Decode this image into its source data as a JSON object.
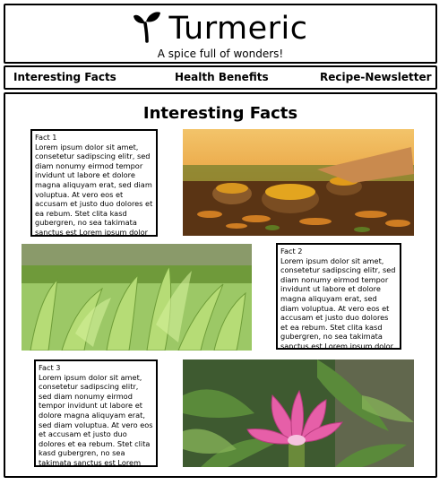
{
  "header": {
    "title": "Turmeric",
    "tagline": "A spice full of wonders!",
    "logo_icon": "sprout-icon"
  },
  "nav": {
    "items": [
      {
        "label": "Interesting Facts"
      },
      {
        "label": "Health Benefits"
      },
      {
        "label": "Recipe-Newsletter"
      }
    ]
  },
  "main": {
    "title": "Interesting Facts",
    "facts": [
      {
        "title": "Fact 1",
        "text": "Lorem ipsum dolor sit amet, consetetur sadipscing elitr, sed diam nonumy eirmod tempor invidunt ut labore et dolore magna aliquyam erat, sed diam voluptua. At vero eos et accusam et justo duo dolores et ea rebum. Stet clita kasd gubergren, no sea takimata sanctus est Lorem ipsum dolor sit amet. Lorem ipsum dolor sit amet, consetetur sadipscing elitr, sed"
      },
      {
        "title": "Fact 2",
        "text": "Lorem ipsum dolor sit amet, consetetur sadipscing elitr, sed diam nonumy eirmod tempor invidunt ut labore et dolore magna aliquyam erat, sed diam voluptua. At vero eos et accusam et justo duo dolores et ea rebum. Stet clita kasd gubergren, no sea takimata sanctus est Lorem ipsum dolor sit amet. Lorem ipsum dolor sit amet, consetetur sadipscing elitr, sed"
      },
      {
        "title": "Fact 3",
        "text": "Lorem ipsum dolor sit amet, consetetur sadipscing elitr, sed diam nonumy eirmod tempor invidunt ut labore et dolore magna aliquyam erat, sed diam voluptua. At vero eos et accusam et justo duo dolores et ea rebum. Stet clita kasd gubergren, no sea takimata sanctus est Lorem ipsum dolor sit amet. Lorem ipsum dolor sit amet, consetetur sadipscing elitr, sed"
      }
    ]
  },
  "colors": {
    "border": "#000000",
    "background": "#ffffff",
    "turmeric_orange": "#d9891e",
    "leaf_green": "#7fb04a",
    "flower_pink": "#e65fa8"
  }
}
